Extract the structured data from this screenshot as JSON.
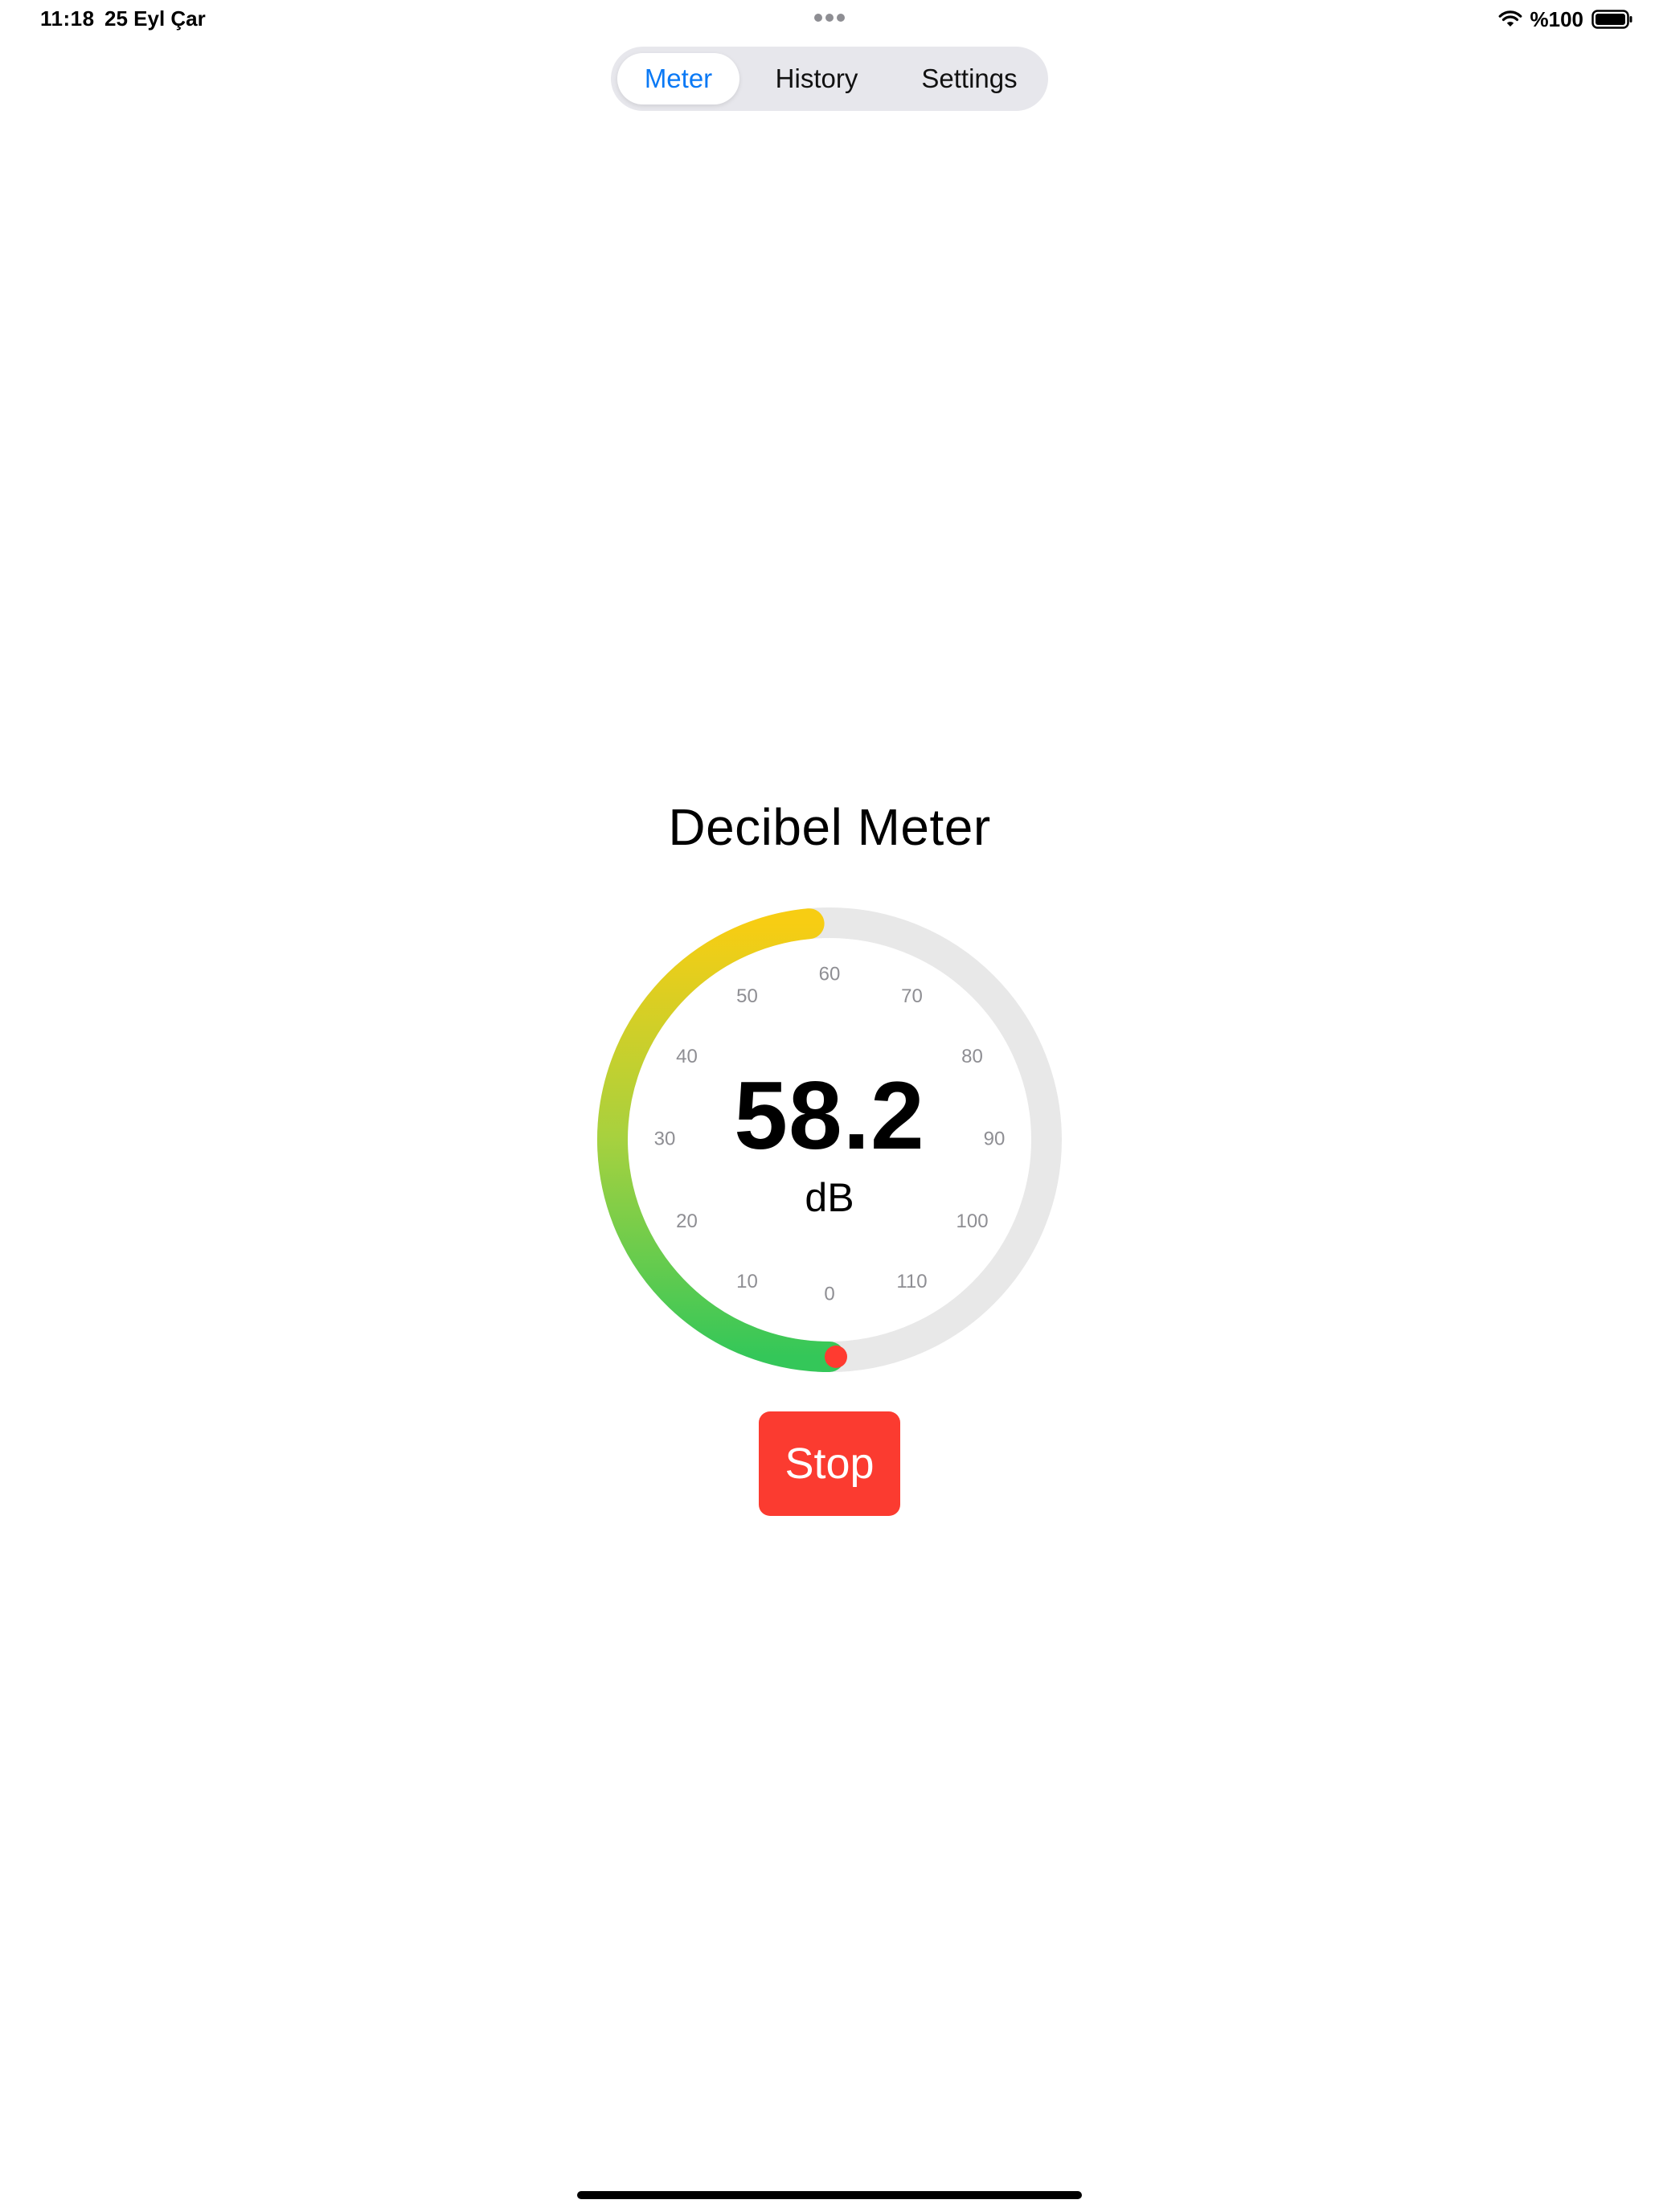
{
  "status_bar": {
    "time": "11:18",
    "date": "25 Eyl Çar",
    "battery": "%100",
    "wifi_icon": "wifi-icon",
    "battery_icon": "battery-full-icon"
  },
  "tabs": [
    {
      "label": "Meter",
      "selected": true
    },
    {
      "label": "History",
      "selected": false
    },
    {
      "label": "Settings",
      "selected": false
    }
  ],
  "meter": {
    "title": "Decibel Meter",
    "value": "58.2",
    "unit": "dB",
    "min": 0,
    "max": 120,
    "level": 58.2,
    "tick_labels": [
      "0",
      "10",
      "20",
      "30",
      "40",
      "50",
      "60",
      "70",
      "80",
      "90",
      "100",
      "110"
    ],
    "colors": {
      "low": "#34c759",
      "mid": "#a6d13f",
      "high": "#f7cd13",
      "track": "#e8e8e8",
      "start_cap": "#ff3b30"
    }
  },
  "controls": {
    "stop_label": "Stop",
    "stop_color": "#ff3b30"
  },
  "accent": "#0a79f5"
}
